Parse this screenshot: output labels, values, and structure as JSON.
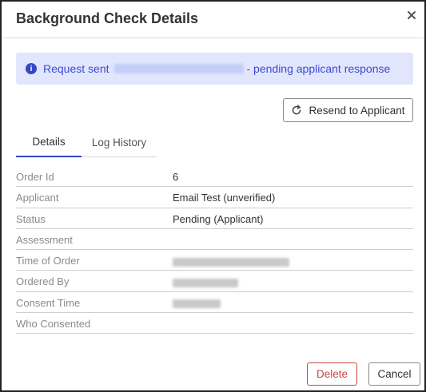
{
  "dialog": {
    "title": "Background Check Details",
    "close_icon": "close-icon"
  },
  "alert": {
    "prefix": "Request sent",
    "suffix": "- pending applicant response",
    "icon": "info-icon",
    "color": "#3448c5"
  },
  "actions": {
    "resend_label": "Resend to Applicant",
    "resend_icon": "refresh-icon"
  },
  "tabs": [
    {
      "label": "Details",
      "active": true
    },
    {
      "label": "Log History",
      "active": false
    }
  ],
  "details": [
    {
      "label": "Order Id",
      "value": "6"
    },
    {
      "label": "Applicant",
      "value": "Email Test (unverified)"
    },
    {
      "label": "Status",
      "value": "Pending (Applicant)"
    },
    {
      "label": "Assessment",
      "value": ""
    },
    {
      "label": "Time of Order",
      "value": ""
    },
    {
      "label": "Ordered By",
      "value": ""
    },
    {
      "label": "Consent Time",
      "value": ""
    },
    {
      "label": "Who Consented",
      "value": ""
    }
  ],
  "footer": {
    "delete_label": "Delete",
    "cancel_label": "Cancel",
    "delete_color": "#c9473f"
  }
}
